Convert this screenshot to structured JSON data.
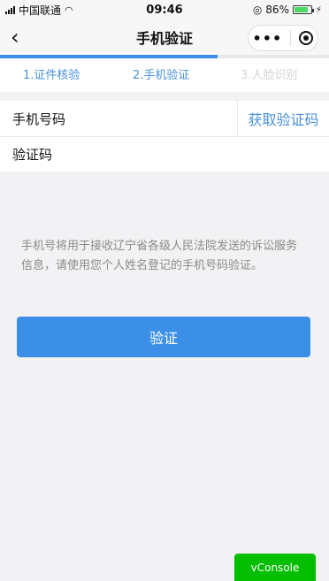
{
  "status_bar": {
    "carrier": "中国联通",
    "time": "09:46",
    "battery_percent": "86%",
    "battery_level": 0.86,
    "icons": [
      "signal-icon",
      "wifi-icon",
      "location-icon",
      "battery-icon",
      "charging-icon"
    ]
  },
  "nav": {
    "title": "手机验证",
    "back_icon": "chevron-left-icon",
    "menu_icon": "more-dots-icon",
    "close_icon": "target-icon"
  },
  "steps": {
    "items": [
      {
        "label": "1.证件核验",
        "state": "done"
      },
      {
        "label": "2.手机验证",
        "state": "active"
      },
      {
        "label": "3.人脸识别",
        "state": "pending"
      }
    ],
    "progress": 0.66,
    "colors": {
      "active": "#4a90d9",
      "pending": "#d3d3d3"
    }
  },
  "form": {
    "phone_label": "手机号码",
    "get_code_label": "获取验证码",
    "code_label": "验证码"
  },
  "notice": "手机号将用于接收辽宁省各级人民法院发送的诉讼服务信息，请使用您个人姓名登记的手机号码验证。",
  "verify_button": "验证",
  "vconsole_label": "vConsole",
  "colors": {
    "primary": "#3c8fe6",
    "vconsole": "#04be02"
  }
}
